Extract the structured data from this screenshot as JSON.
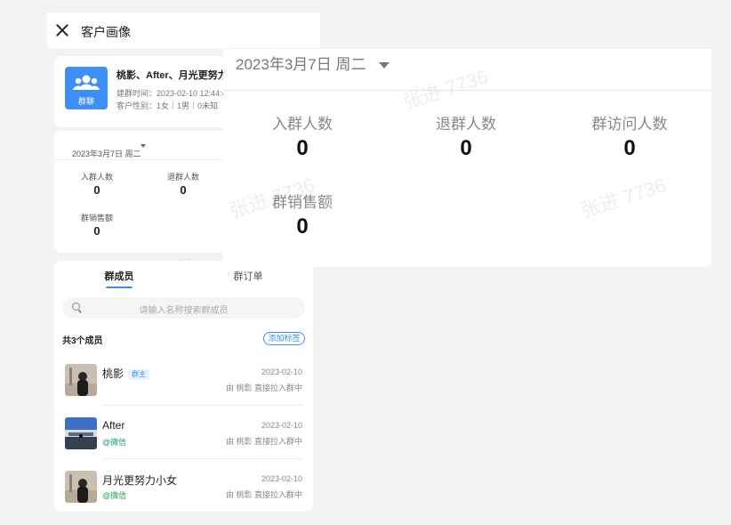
{
  "header": {
    "title": "客户画像"
  },
  "group": {
    "avatar_label": "群聊",
    "name": "桃影、After、月光更努力小",
    "created": "建群时间：2023-02-10 12:44:4",
    "gender": "客户性别：1女｜1男｜0未知"
  },
  "stats": {
    "date": "2023年3月7日 周二",
    "join_label": "入群人数",
    "join_value": "0",
    "leave_label": "退群人数",
    "leave_value": "0",
    "sales_label": "群销售额",
    "sales_value": "0"
  },
  "overlay": {
    "date": "2023年3月7日 周二",
    "join_label": "入群人数",
    "join_value": "0",
    "leave_label": "退群人数",
    "leave_value": "0",
    "visit_label": "群访问人数",
    "visit_value": "0",
    "sales_label": "群销售额",
    "sales_value": "0"
  },
  "tabs": [
    {
      "label": "群成员"
    },
    {
      "label": "群订单"
    }
  ],
  "search": {
    "placeholder": "请输入名称搜索群成员"
  },
  "members_count": "共3个成员",
  "add_tag_label": "添加标签",
  "members": [
    {
      "name": "桃影",
      "badge": "群主",
      "date": "2023-02-10",
      "via": "由 桃影 直接拉入群中"
    },
    {
      "name": "After",
      "source": "@微信",
      "date": "2023-02-10",
      "via": "由 桃影 直接拉入群中"
    },
    {
      "name": "月光更努力小女",
      "source": "@微信",
      "date": "2023-02-10",
      "via": "由 桃影 直接拉入群中"
    }
  ],
  "watermark": "张进 7736",
  "colors": {
    "accent": "#3e8ef7",
    "wechat": "#18a058"
  }
}
